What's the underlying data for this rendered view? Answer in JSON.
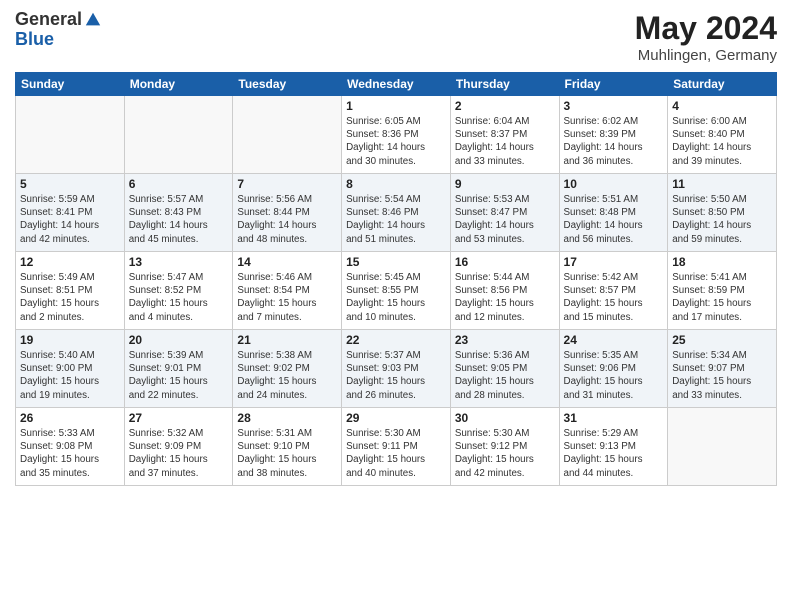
{
  "header": {
    "logo_general": "General",
    "logo_blue": "Blue",
    "month_title": "May 2024",
    "location": "Muhlingen, Germany"
  },
  "days_of_week": [
    "Sunday",
    "Monday",
    "Tuesday",
    "Wednesday",
    "Thursday",
    "Friday",
    "Saturday"
  ],
  "weeks": [
    [
      {
        "day": "",
        "info": ""
      },
      {
        "day": "",
        "info": ""
      },
      {
        "day": "",
        "info": ""
      },
      {
        "day": "1",
        "info": "Sunrise: 6:05 AM\nSunset: 8:36 PM\nDaylight: 14 hours\nand 30 minutes."
      },
      {
        "day": "2",
        "info": "Sunrise: 6:04 AM\nSunset: 8:37 PM\nDaylight: 14 hours\nand 33 minutes."
      },
      {
        "day": "3",
        "info": "Sunrise: 6:02 AM\nSunset: 8:39 PM\nDaylight: 14 hours\nand 36 minutes."
      },
      {
        "day": "4",
        "info": "Sunrise: 6:00 AM\nSunset: 8:40 PM\nDaylight: 14 hours\nand 39 minutes."
      }
    ],
    [
      {
        "day": "5",
        "info": "Sunrise: 5:59 AM\nSunset: 8:41 PM\nDaylight: 14 hours\nand 42 minutes."
      },
      {
        "day": "6",
        "info": "Sunrise: 5:57 AM\nSunset: 8:43 PM\nDaylight: 14 hours\nand 45 minutes."
      },
      {
        "day": "7",
        "info": "Sunrise: 5:56 AM\nSunset: 8:44 PM\nDaylight: 14 hours\nand 48 minutes."
      },
      {
        "day": "8",
        "info": "Sunrise: 5:54 AM\nSunset: 8:46 PM\nDaylight: 14 hours\nand 51 minutes."
      },
      {
        "day": "9",
        "info": "Sunrise: 5:53 AM\nSunset: 8:47 PM\nDaylight: 14 hours\nand 53 minutes."
      },
      {
        "day": "10",
        "info": "Sunrise: 5:51 AM\nSunset: 8:48 PM\nDaylight: 14 hours\nand 56 minutes."
      },
      {
        "day": "11",
        "info": "Sunrise: 5:50 AM\nSunset: 8:50 PM\nDaylight: 14 hours\nand 59 minutes."
      }
    ],
    [
      {
        "day": "12",
        "info": "Sunrise: 5:49 AM\nSunset: 8:51 PM\nDaylight: 15 hours\nand 2 minutes."
      },
      {
        "day": "13",
        "info": "Sunrise: 5:47 AM\nSunset: 8:52 PM\nDaylight: 15 hours\nand 4 minutes."
      },
      {
        "day": "14",
        "info": "Sunrise: 5:46 AM\nSunset: 8:54 PM\nDaylight: 15 hours\nand 7 minutes."
      },
      {
        "day": "15",
        "info": "Sunrise: 5:45 AM\nSunset: 8:55 PM\nDaylight: 15 hours\nand 10 minutes."
      },
      {
        "day": "16",
        "info": "Sunrise: 5:44 AM\nSunset: 8:56 PM\nDaylight: 15 hours\nand 12 minutes."
      },
      {
        "day": "17",
        "info": "Sunrise: 5:42 AM\nSunset: 8:57 PM\nDaylight: 15 hours\nand 15 minutes."
      },
      {
        "day": "18",
        "info": "Sunrise: 5:41 AM\nSunset: 8:59 PM\nDaylight: 15 hours\nand 17 minutes."
      }
    ],
    [
      {
        "day": "19",
        "info": "Sunrise: 5:40 AM\nSunset: 9:00 PM\nDaylight: 15 hours\nand 19 minutes."
      },
      {
        "day": "20",
        "info": "Sunrise: 5:39 AM\nSunset: 9:01 PM\nDaylight: 15 hours\nand 22 minutes."
      },
      {
        "day": "21",
        "info": "Sunrise: 5:38 AM\nSunset: 9:02 PM\nDaylight: 15 hours\nand 24 minutes."
      },
      {
        "day": "22",
        "info": "Sunrise: 5:37 AM\nSunset: 9:03 PM\nDaylight: 15 hours\nand 26 minutes."
      },
      {
        "day": "23",
        "info": "Sunrise: 5:36 AM\nSunset: 9:05 PM\nDaylight: 15 hours\nand 28 minutes."
      },
      {
        "day": "24",
        "info": "Sunrise: 5:35 AM\nSunset: 9:06 PM\nDaylight: 15 hours\nand 31 minutes."
      },
      {
        "day": "25",
        "info": "Sunrise: 5:34 AM\nSunset: 9:07 PM\nDaylight: 15 hours\nand 33 minutes."
      }
    ],
    [
      {
        "day": "26",
        "info": "Sunrise: 5:33 AM\nSunset: 9:08 PM\nDaylight: 15 hours\nand 35 minutes."
      },
      {
        "day": "27",
        "info": "Sunrise: 5:32 AM\nSunset: 9:09 PM\nDaylight: 15 hours\nand 37 minutes."
      },
      {
        "day": "28",
        "info": "Sunrise: 5:31 AM\nSunset: 9:10 PM\nDaylight: 15 hours\nand 38 minutes."
      },
      {
        "day": "29",
        "info": "Sunrise: 5:30 AM\nSunset: 9:11 PM\nDaylight: 15 hours\nand 40 minutes."
      },
      {
        "day": "30",
        "info": "Sunrise: 5:30 AM\nSunset: 9:12 PM\nDaylight: 15 hours\nand 42 minutes."
      },
      {
        "day": "31",
        "info": "Sunrise: 5:29 AM\nSunset: 9:13 PM\nDaylight: 15 hours\nand 44 minutes."
      },
      {
        "day": "",
        "info": ""
      }
    ]
  ]
}
